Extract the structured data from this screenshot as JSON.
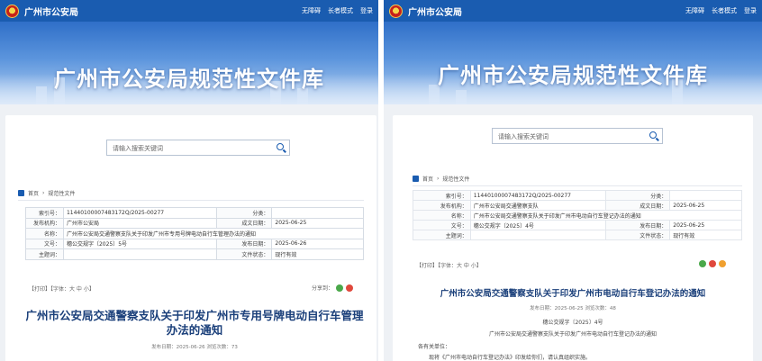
{
  "site_name": "广州市公安局",
  "banner_title": "广州市公安局规范性文件库",
  "left": {
    "nav": [
      "无障碍",
      "长者模式",
      "登录"
    ],
    "search_placeholder": "请输入搜索关键词",
    "breadcrumb": [
      "首页",
      "规范性文件"
    ],
    "meta": [
      [
        "索引号：",
        "11440100007483172Q/2025-00277",
        "分类：",
        ""
      ],
      [
        "发布机构：",
        "广州市公安局",
        "成文日期：",
        "2025-06-25"
      ],
      [
        "名称：",
        "广州市公安局交通警察支队关于印发广州市专用号牌电动自行车管理办法的通知",
        "",
        ""
      ],
      [
        "文号：",
        "穗公交规字〔2025〕5号",
        "发布日期：",
        "2025-06-26"
      ],
      [
        "主题词：",
        "",
        "文件状态：",
        "现行有效"
      ]
    ],
    "tools": "【打印】【字体：大 中 小】",
    "share": "分享到：",
    "doc_title": "广州市公安局交通警察支队关于印发广州市专用号牌电动自行车管理办法的通知",
    "pub_info": "发布日期：2025-06-26  浏览次数：73"
  },
  "right": {
    "nav": [
      "无障碍",
      "长者模式",
      "登录"
    ],
    "search_placeholder": "请输入搜索关键词",
    "breadcrumb": [
      "首页",
      "规范性文件"
    ],
    "meta": [
      [
        "索引号：",
        "11440100007483172Q/2025-00277",
        "分类：",
        ""
      ],
      [
        "发布机构：",
        "广州市公安局交通警察支队",
        "成文日期：",
        "2025-06-25"
      ],
      [
        "名称：",
        "广州市公安局交通警察支队关于印发广州市电动自行车登记办法的通知",
        "",
        ""
      ],
      [
        "文号：",
        "穗公交规字〔2025〕4号",
        "发布日期：",
        "2025-06-25"
      ],
      [
        "主题词：",
        "",
        "文件状态：",
        "现行有效"
      ]
    ],
    "tools": "【打印】【字体：大 中 小】",
    "doc_title": "广州市公安局交通警察支队关于印发广州市电动自行车登记办法的通知",
    "pub_info": "发布日期：2025-06-25  浏览次数：48",
    "doc_no": "穗公交规字〔2025〕4号",
    "subtitle": "广州市公安局交通警察支队关于印发广州市电动自行车登记办法的通知",
    "salutation": "各有关单位：",
    "body_start": "现将《广州市电动自行车登记办法》印发给你们，请认真组织实施。"
  },
  "colors": {
    "brand": "#1a5cb0",
    "title": "#1a3f7a"
  }
}
